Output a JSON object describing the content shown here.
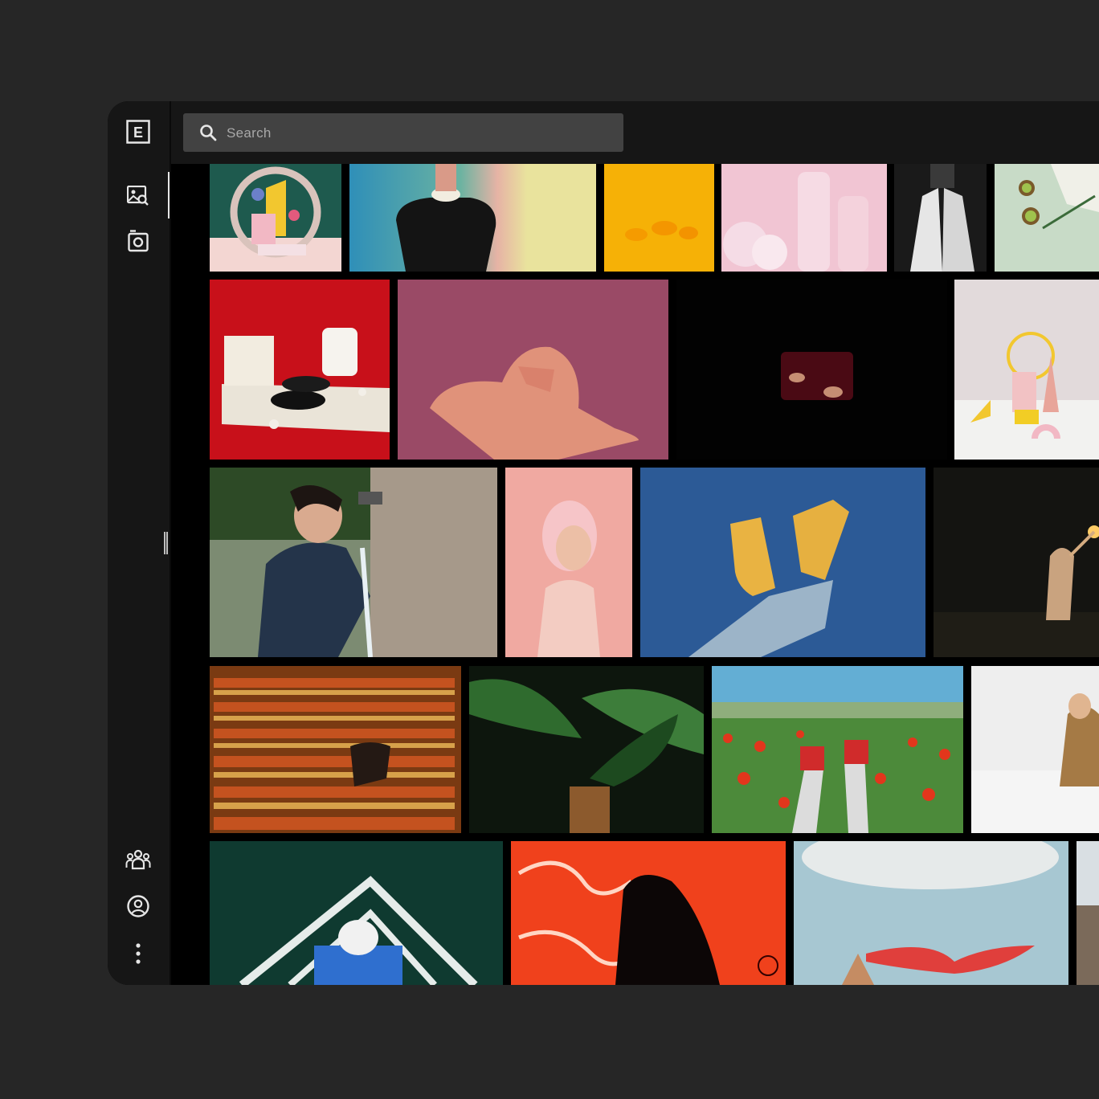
{
  "app": {
    "logo_letter": "E",
    "colors": {
      "background": "#262626",
      "sidebar": "#161616",
      "search_bg": "#424242",
      "accent": "#e6e6e6"
    }
  },
  "sidebar": {
    "top_items": [
      {
        "name": "browse-gallery",
        "icon": "image-search-icon",
        "active": true
      },
      {
        "name": "camera-upload",
        "icon": "camera-icon",
        "active": false
      }
    ],
    "bottom_items": [
      {
        "name": "community",
        "icon": "group-icon"
      },
      {
        "name": "profile",
        "icon": "user-circle-icon"
      },
      {
        "name": "more",
        "icon": "more-vertical-icon"
      }
    ]
  },
  "search": {
    "placeholder": "Search",
    "value": ""
  },
  "gallery": {
    "rows": [
      [
        "paper-sculpture-pastel",
        "person-colored-wall",
        "oranges-on-yellow",
        "pink-plastic-bottles",
        "white-pants-legs",
        "kiwi-chopsticks"
      ],
      [
        "shoes-tie-red-set",
        "hands-on-back-pink",
        "hands-in-dark",
        "yellow-ring-still-life"
      ],
      [
        "woman-drinking-tap",
        "pink-haired-woman",
        "yellow-sneakers-sky",
        "figures-night-sparkler"
      ],
      [
        "red-theater-seats",
        "banana-leaves-night",
        "sneakers-poppy-field",
        "woman-white-steps"
      ],
      [
        "field-lines-aerial",
        "neon-sign-silhouette",
        "red-scarf-sky",
        "city-edge"
      ]
    ]
  }
}
